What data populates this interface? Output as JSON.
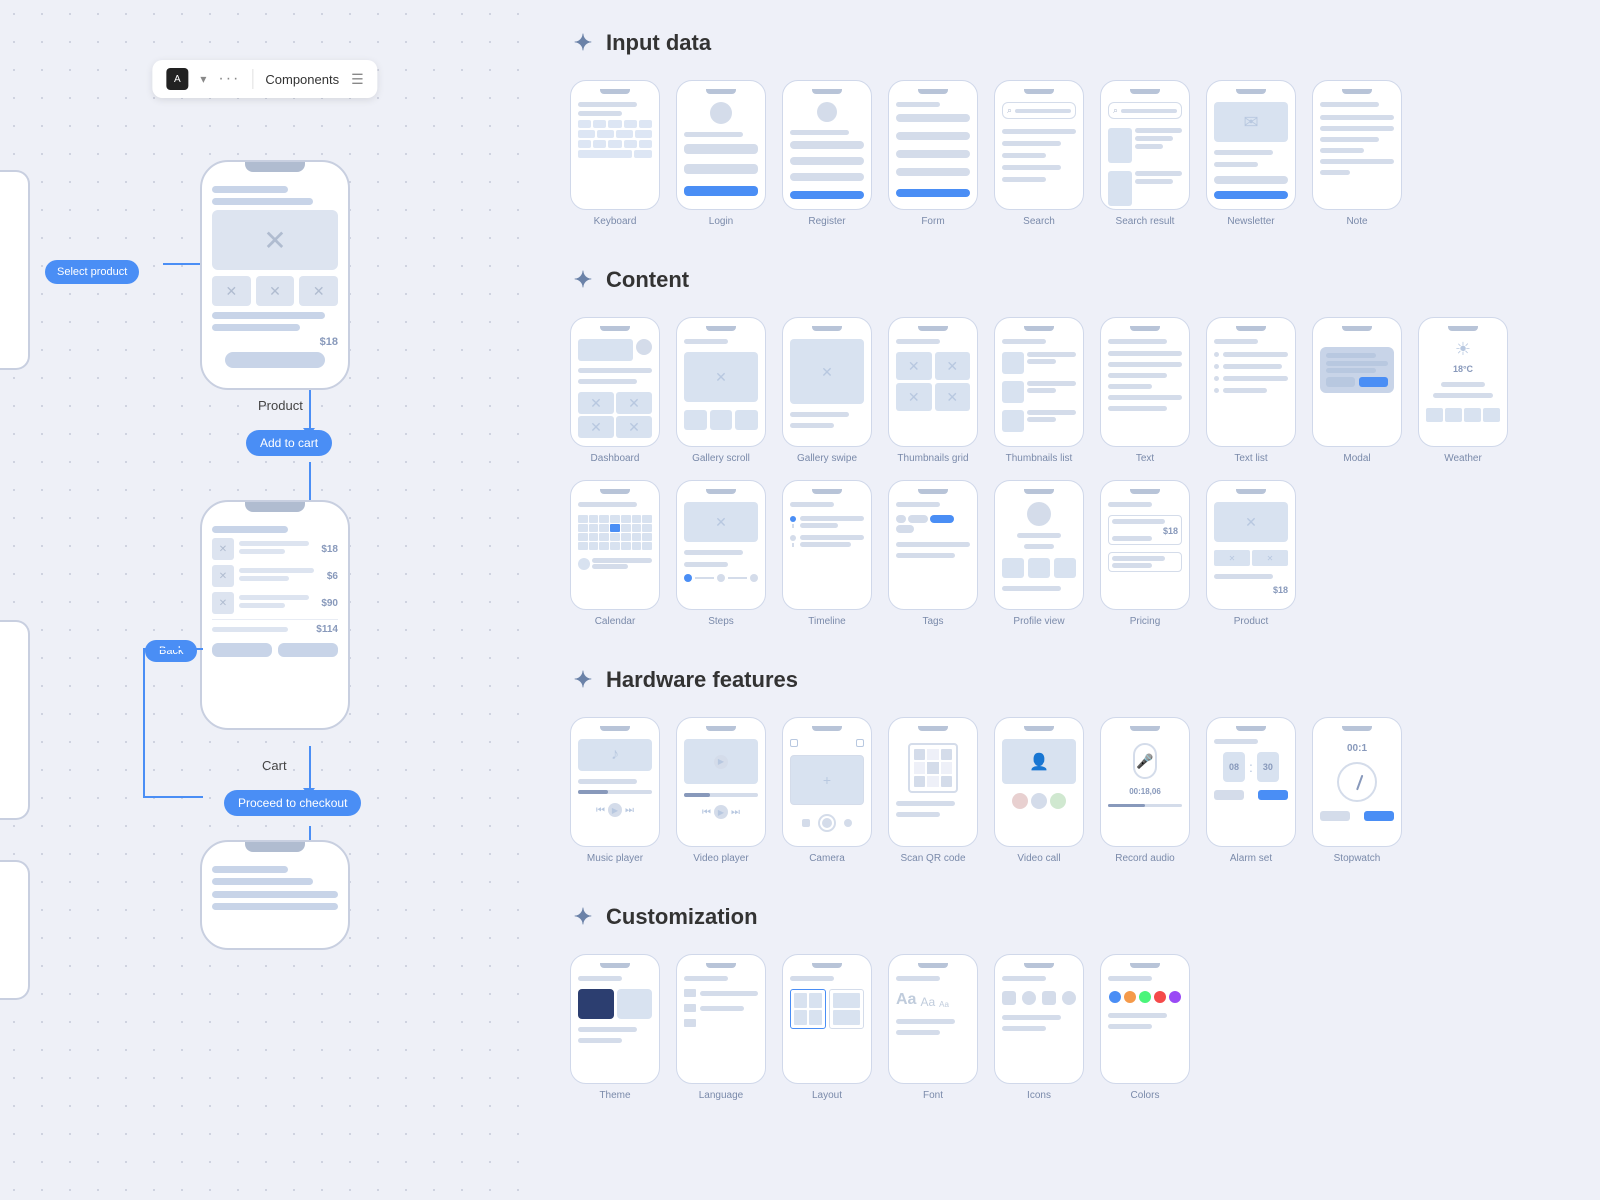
{
  "left": {
    "toolbar": {
      "icon_label": "A",
      "chevron": "▾",
      "dots": "···",
      "components_label": "Components",
      "list_icon": "☰"
    },
    "nodes": {
      "select_product": "Select product",
      "product_label": "Product",
      "add_to_cart": "Add to cart",
      "cart_label": "Cart",
      "back_label": "Back",
      "proceed_checkout": "Proceed to checkout",
      "product_price": "$18",
      "cart_prices": [
        "$18",
        "$6",
        "$90",
        "$114"
      ]
    }
  },
  "right": {
    "sections": [
      {
        "id": "input-data",
        "title": "Input data",
        "components": [
          {
            "label": "Keyboard",
            "type": "keyboard"
          },
          {
            "label": "Login",
            "type": "login"
          },
          {
            "label": "Register",
            "type": "register"
          },
          {
            "label": "Form",
            "type": "form"
          },
          {
            "label": "Search",
            "type": "search"
          },
          {
            "label": "Search result",
            "type": "search-result"
          },
          {
            "label": "Newsletter",
            "type": "newsletter"
          },
          {
            "label": "Note",
            "type": "note"
          }
        ]
      },
      {
        "id": "content",
        "title": "Content",
        "components": [
          {
            "label": "Dashboard",
            "type": "dashboard"
          },
          {
            "label": "Gallery scroll",
            "type": "gallery-scroll"
          },
          {
            "label": "Gallery swipe",
            "type": "gallery-swipe"
          },
          {
            "label": "Thumbnails grid",
            "type": "thumbnails-grid"
          },
          {
            "label": "Thumbnails list",
            "type": "thumbnails-list"
          },
          {
            "label": "Text",
            "type": "text"
          },
          {
            "label": "Text list",
            "type": "text-list"
          },
          {
            "label": "Modal",
            "type": "modal"
          },
          {
            "label": "Weather",
            "type": "weather"
          },
          {
            "label": "Calendar",
            "type": "calendar"
          },
          {
            "label": "Steps",
            "type": "steps"
          },
          {
            "label": "Timeline",
            "type": "timeline"
          },
          {
            "label": "Tags",
            "type": "tags"
          },
          {
            "label": "Profile view",
            "type": "profile-view"
          },
          {
            "label": "Pricing",
            "type": "pricing"
          },
          {
            "label": "Product",
            "type": "product-content"
          }
        ]
      },
      {
        "id": "hardware",
        "title": "Hardware features",
        "components": [
          {
            "label": "Music player",
            "type": "music-player"
          },
          {
            "label": "Video player",
            "type": "video-player"
          },
          {
            "label": "Camera",
            "type": "camera"
          },
          {
            "label": "Scan QR code",
            "type": "scan-qr"
          },
          {
            "label": "Video call",
            "type": "video-call"
          },
          {
            "label": "Record audio",
            "type": "record-audio"
          },
          {
            "label": "Alarm set",
            "type": "alarm-set"
          },
          {
            "label": "Stopwatch",
            "type": "stopwatch"
          }
        ]
      },
      {
        "id": "customization",
        "title": "Customization",
        "components": [
          {
            "label": "Theme",
            "type": "theme"
          },
          {
            "label": "Language",
            "type": "language"
          },
          {
            "label": "Layout",
            "type": "layout"
          },
          {
            "label": "Font",
            "type": "font"
          },
          {
            "label": "Icons",
            "type": "icons"
          },
          {
            "label": "Colors",
            "type": "colors"
          }
        ]
      }
    ]
  },
  "icons": {
    "section_icon": "✦",
    "gear_icon": "⚙"
  }
}
